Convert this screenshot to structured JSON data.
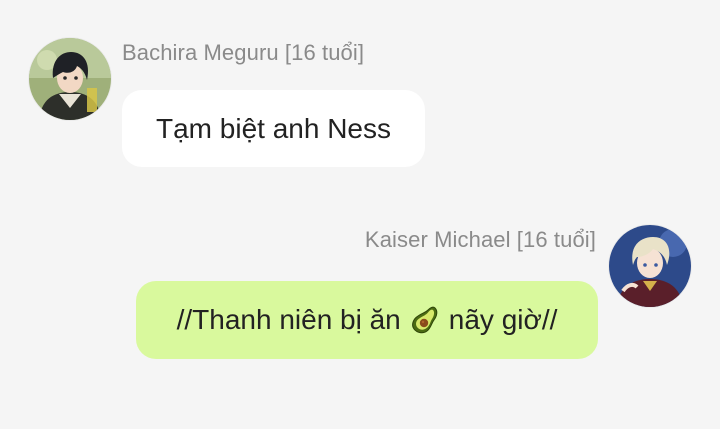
{
  "messages": [
    {
      "sender": "Bachira Meguru [16 tuổi]",
      "text": "Tạm biệt anh Ness",
      "side": "left",
      "bubble_color": "#ffffff",
      "avatar_icon": "anime-boy-dark-hair-avatar"
    },
    {
      "sender": "Kaiser Michael [16 tuổi]",
      "text_before": "//Thanh niên bị ăn",
      "emoji": "avocado-icon",
      "text_after": "nãy giờ//",
      "side": "right",
      "bubble_color": "#d9f99d",
      "avatar_icon": "anime-boy-blonde-hair-avatar"
    }
  ],
  "colors": {
    "background": "#f5f5f5",
    "name_text": "#8a8a8a",
    "message_text": "#222222"
  }
}
